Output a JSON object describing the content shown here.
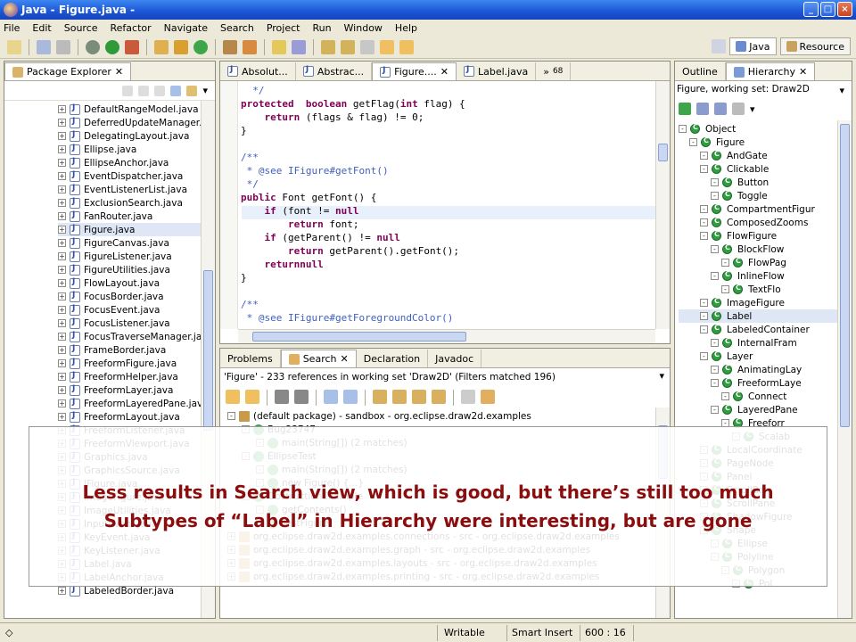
{
  "window": {
    "title": "Java - Figure.java -"
  },
  "menu": [
    "File",
    "Edit",
    "Source",
    "Refactor",
    "Navigate",
    "Search",
    "Project",
    "Run",
    "Window",
    "Help"
  ],
  "perspectives": [
    {
      "label": "Java",
      "icon": "java-perspective-icon"
    },
    {
      "label": "Resource",
      "icon": "resource-perspective-icon"
    }
  ],
  "package_explorer": {
    "title": "Package Explorer",
    "items": [
      "DefaultRangeModel.java",
      "DeferredUpdateManager.ja",
      "DelegatingLayout.java",
      "Ellipse.java",
      "EllipseAnchor.java",
      "EventDispatcher.java",
      "EventListenerList.java",
      "ExclusionSearch.java",
      "FanRouter.java",
      "Figure.java",
      "FigureCanvas.java",
      "FigureListener.java",
      "FigureUtilities.java",
      "FlowLayout.java",
      "FocusBorder.java",
      "FocusEvent.java",
      "FocusListener.java",
      "FocusTraverseManager.java",
      "FrameBorder.java",
      "FreeformFigure.java",
      "FreeformHelper.java",
      "FreeformLayer.java",
      "FreeformLayeredPane.java",
      "FreeformLayout.java",
      "FreeformListener.java",
      "FreeformViewport.java",
      "Graphics.java",
      "GraphicsSource.java",
      "IFigure.java",
      "ImageFigure.java",
      "ImageUtilities.java",
      "InputEvent.java",
      "KeyEvent.java",
      "KeyListener.java",
      "Label.java",
      "LabelAnchor.java",
      "LabeledBorder.java"
    ]
  },
  "editor": {
    "tabs": [
      "Absolut...",
      "Abstrac...",
      "Figure....",
      "Label.java"
    ],
    "overflow": "68",
    "code_lines": [
      [
        [
          "cm",
          "  */"
        ]
      ],
      [
        [
          "kw",
          "protected"
        ],
        [
          "",
          "  "
        ],
        [
          "kw",
          "boolean"
        ],
        [
          "",
          " getFlag("
        ],
        [
          "kw",
          "int"
        ],
        [
          "",
          " flag) {"
        ]
      ],
      [
        [
          "",
          "    "
        ],
        [
          "kw",
          "return"
        ],
        [
          "",
          " (flags & flag) != 0;"
        ]
      ],
      [
        [
          "",
          "}"
        ]
      ],
      [
        [
          "",
          ""
        ]
      ],
      [
        [
          "cm",
          "/**"
        ]
      ],
      [
        [
          "cm",
          " * @see IFigure#getFont()"
        ]
      ],
      [
        [
          "cm",
          " */"
        ]
      ],
      [
        [
          "kw",
          "public"
        ],
        [
          "",
          " Font getFont() {"
        ]
      ],
      [
        [
          "",
          "    "
        ],
        [
          "kw",
          "if"
        ],
        [
          "",
          " (font != "
        ],
        [
          "kw",
          "null"
        ],
        [
          ")"
        ]
      ],
      [
        [
          "",
          "        "
        ],
        [
          "kw",
          "return"
        ],
        [
          "",
          " font;"
        ]
      ],
      [
        [
          "",
          "    "
        ],
        [
          "kw",
          "if"
        ],
        [
          "",
          " (getParent() != "
        ],
        [
          "kw",
          "null"
        ],
        [
          ")"
        ]
      ],
      [
        [
          "",
          "        "
        ],
        [
          "kw",
          "return"
        ],
        [
          "",
          " getParent().getFont();"
        ]
      ],
      [
        [
          "",
          "    "
        ],
        [
          "kw",
          "return"
        ],
        [
          " "
        ],
        [
          "kw",
          "null"
        ],
        [
          ";"
        ]
      ],
      [
        [
          "",
          "}"
        ]
      ],
      [
        [
          "",
          ""
        ]
      ],
      [
        [
          "cm",
          "/**"
        ]
      ],
      [
        [
          "cm",
          " * @see IFigure#getForegroundColor()"
        ]
      ]
    ]
  },
  "search": {
    "tabs": [
      "Problems",
      "Search",
      "Declaration",
      "Javadoc"
    ],
    "summary": "'Figure' - 233 references in working set 'Draw2D' (Filters matched 196)",
    "results": [
      "(default package) - sandbox - org.eclipse.draw2d.examples",
      "Bug23747",
      "main(String[]) (2 matches)",
      "EllipseTest",
      "main(String[]) (2 matches)",
      "new Figure() {...}",
      "ObstructionExample",
      "getContents()",
      "TestFigure",
      "org.eclipse.draw2d.examples.connections - src - org.eclipse.draw2d.examples",
      "org.eclipse.draw2d.examples.graph - src - org.eclipse.draw2d.examples",
      "org.eclipse.draw2d.examples.layouts - src - org.eclipse.draw2d.examples",
      "org.eclipse.draw2d.examples.printing - src - org.eclipse.draw2d.examples"
    ]
  },
  "hierarchy": {
    "tabs": [
      "Outline",
      "Hierarchy"
    ],
    "subtitle": "Figure, working set: Draw2D",
    "nodes": [
      {
        "label": "Object"
      },
      {
        "label": "Figure"
      },
      {
        "label": "AndGate"
      },
      {
        "label": "Clickable"
      },
      {
        "label": "Button"
      },
      {
        "label": "Toggle"
      },
      {
        "label": "CompartmentFigur"
      },
      {
        "label": "ComposedZooms"
      },
      {
        "label": "FlowFigure"
      },
      {
        "label": "BlockFlow"
      },
      {
        "label": "FlowPag"
      },
      {
        "label": "InlineFlow"
      },
      {
        "label": "TextFlo"
      },
      {
        "label": "ImageFigure"
      },
      {
        "label": "Label"
      },
      {
        "label": "LabeledContainer"
      },
      {
        "label": "InternalFram"
      },
      {
        "label": "Layer"
      },
      {
        "label": "AnimatingLay"
      },
      {
        "label": "FreeformLaye"
      },
      {
        "label": "Connect"
      },
      {
        "label": "LayeredPane"
      },
      {
        "label": "Freeforr"
      },
      {
        "label": "Scalab"
      },
      {
        "label": "LocalCoordinate"
      },
      {
        "label": "PageNode"
      },
      {
        "label": "Panel"
      },
      {
        "label": "ScrollBar"
      },
      {
        "label": "ScrollPane"
      },
      {
        "label": "ShadowFigure"
      },
      {
        "label": "Shape"
      },
      {
        "label": "Ellipse"
      },
      {
        "label": "Polyline"
      },
      {
        "label": "Polygon"
      },
      {
        "label": "Pol"
      }
    ]
  },
  "status": {
    "writable": "Writable",
    "insert": "Smart Insert",
    "position": "600 : 16"
  },
  "overlay": {
    "line1": "Less results in Search view, which is good, but there’s still too much",
    "line2": "Subtypes of “Label” in Hierarchy were interesting, but are gone"
  }
}
